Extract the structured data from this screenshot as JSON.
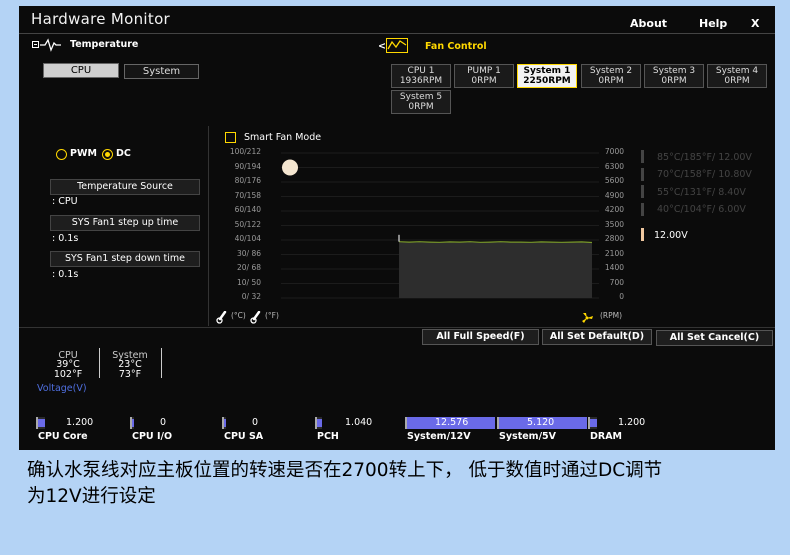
{
  "window": {
    "title": "Hardware Monitor",
    "about": "About",
    "help": "Help",
    "close": "X"
  },
  "temperature": {
    "title": "Temperature",
    "tabs": [
      {
        "label": "CPU",
        "active": true
      },
      {
        "label": "System",
        "active": false
      }
    ]
  },
  "fan_control": {
    "arrow": "<",
    "title": "Fan Control"
  },
  "fans": [
    {
      "name": "CPU 1",
      "rpm": "1936RPM",
      "selected": false
    },
    {
      "name": "PUMP 1",
      "rpm": "0RPM",
      "selected": false
    },
    {
      "name": "System 1",
      "rpm": "2250RPM",
      "selected": true
    },
    {
      "name": "System 2",
      "rpm": "0RPM",
      "selected": false
    },
    {
      "name": "System 3",
      "rpm": "0RPM",
      "selected": false
    },
    {
      "name": "System 4",
      "rpm": "0RPM",
      "selected": false
    },
    {
      "name": "System 5",
      "rpm": "0RPM",
      "selected": false
    }
  ],
  "mode": {
    "pwm": "PWM",
    "dc": "DC",
    "selected": "DC"
  },
  "left_panel": {
    "temp_source_label": "Temperature Source",
    "temp_source_value": ": CPU",
    "step_up_label": "SYS Fan1 step up time",
    "step_up_value": ": 0.1s",
    "step_down_label": "SYS Fan1 step down time",
    "step_down_value": ": 0.1s"
  },
  "smart_fan": {
    "label": "Smart Fan Mode",
    "checked": false
  },
  "chart_data": {
    "type": "line",
    "left_axis_labels": [
      "100/212",
      "90/194",
      "80/176",
      "70/158",
      "60/140",
      "50/122",
      "40/104",
      "30/ 86",
      "20/ 68",
      "10/ 50",
      "0/ 32"
    ],
    "right_axis_labels": [
      "7000",
      "6300",
      "5600",
      "4900",
      "4200",
      "3500",
      "2800",
      "2100",
      "1400",
      "700",
      "0"
    ],
    "y_right_range": [
      0,
      7000
    ],
    "series": [
      {
        "values": [
          2720,
          2700,
          2720,
          2700,
          2690,
          2710,
          2700,
          2720,
          2690,
          2700,
          2720,
          2700,
          2700,
          2690,
          2710,
          2700,
          2690,
          2700,
          2710,
          2680
        ]
      }
    ],
    "handle": {
      "temp_c": 90
    },
    "left_unit_c": "(°C)",
    "left_unit_f": "(°F)",
    "right_unit": "(RPM)"
  },
  "voltage_levels": [
    {
      "text": "85°C/185°F/ 12.00V",
      "active": false
    },
    {
      "text": "70°C/158°F/ 10.80V",
      "active": false
    },
    {
      "text": "55°C/131°F/  8.40V",
      "active": false
    },
    {
      "text": "40°C/104°F/  6.00V",
      "active": false
    },
    {
      "text": "12.00V",
      "active": true
    }
  ],
  "buttons": {
    "full_speed": "All Full Speed(F)",
    "set_default": "All Set Default(D)",
    "set_cancel": "All Set Cancel(C)"
  },
  "monitor": {
    "cpu_label": "CPU",
    "cpu_c": "39°C",
    "cpu_f": "102°F",
    "sys_label": "System",
    "sys_c": "23°C",
    "sys_f": "73°F",
    "voltage_label": "Voltage(V)"
  },
  "voltages": [
    {
      "name": "CPU Core",
      "value": "1.200",
      "level": 0.1
    },
    {
      "name": "CPU I/O",
      "value": "0",
      "level": 0
    },
    {
      "name": "CPU SA",
      "value": "0",
      "level": 0
    },
    {
      "name": "PCH",
      "value": "1.040",
      "level": 0.08
    },
    {
      "name": "System/12V",
      "value": "12.576",
      "level": 1.0
    },
    {
      "name": "System/5V",
      "value": "5.120",
      "level": 1.0
    },
    {
      "name": "DRAM",
      "value": "1.200",
      "level": 0.1
    }
  ],
  "caption": {
    "line1": "确认水泵线对应主板位置的转速是否在2700转上下， 低于数值时通过DC调节",
    "line2": "为12V进行设定"
  }
}
